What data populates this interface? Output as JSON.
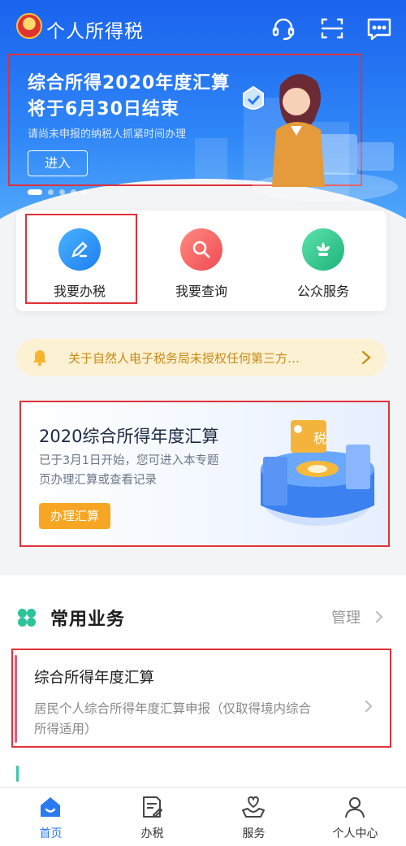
{
  "header": {
    "title": "个人所得税",
    "icons": [
      "headset-icon",
      "scan-icon",
      "message-icon"
    ]
  },
  "banner": {
    "title_line1": "综合所得2020年度汇算",
    "title_line2": "将于6月30日结束",
    "subtitle": "请尚未申报的纳税人抓紧时间办理",
    "button": "进入",
    "carousel": {
      "count": 5,
      "active_index": 0
    }
  },
  "services": [
    {
      "label": "我要办税",
      "icon": "pencil-icon",
      "color": "#2d8cf0"
    },
    {
      "label": "我要查询",
      "icon": "search-icon",
      "color": "#f0565a"
    },
    {
      "label": "公众服务",
      "icon": "flower-icon",
      "color": "#2bc28c"
    }
  ],
  "notice": {
    "text": "关于自然人电子税务局未授权任何第三方…"
  },
  "promo": {
    "title": "2020综合所得年度汇算",
    "desc_line1": "已于3月1日开始，您可进入本专题",
    "desc_line2": "页办理汇算或查看记录",
    "button": "办理汇算",
    "illus_tag": "税"
  },
  "common": {
    "title": "常用业务",
    "manage": "管理",
    "item": {
      "title": "综合所得年度汇算",
      "desc_line1": "居民个人综合所得年度汇算申报（仅取得境内综合",
      "desc_line2": "所得适用）"
    }
  },
  "tabs": [
    {
      "label": "首页",
      "icon": "home-icon",
      "active": true
    },
    {
      "label": "办税",
      "icon": "document-icon",
      "active": false
    },
    {
      "label": "服务",
      "icon": "heart-hand-icon",
      "active": false
    },
    {
      "label": "个人中心",
      "icon": "person-icon",
      "active": false
    }
  ],
  "colors": {
    "primary": "#2a7af2",
    "highlight_border": "#e0313a",
    "warning": "#f6a623"
  }
}
